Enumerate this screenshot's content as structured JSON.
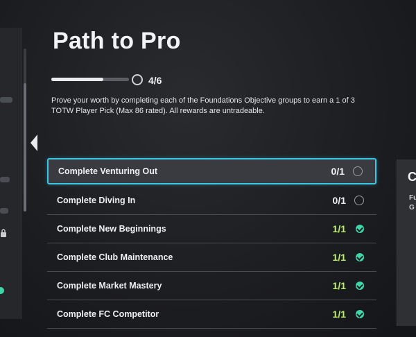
{
  "header": {
    "title": "Path to Pro",
    "progress_text": "4/6",
    "progress_fraction": 0.6667,
    "description": "Prove your worth by completing each of the Foundations Objective groups to earn a 1 of 3 TOTW Player Pick (Max 86 rated). All rewards are untradeable."
  },
  "objectives": [
    {
      "label": "Complete Venturing Out",
      "count": "0/1",
      "status": "empty-circle-icon"
    },
    {
      "label": "Complete Diving In",
      "count": "0/1",
      "status": "empty-circle-icon"
    },
    {
      "label": "Complete New Beginnings",
      "count": "1/1",
      "status": "check-icon"
    },
    {
      "label": "Complete Club Maintenance",
      "count": "1/1",
      "status": "check-icon"
    },
    {
      "label": "Complete Market Mastery",
      "count": "1/1",
      "status": "check-icon"
    },
    {
      "label": "Complete FC Competitor",
      "count": "1/1",
      "status": "check-icon"
    }
  ],
  "right_panel": {
    "initial": "C",
    "line1": "Fu",
    "line2": "G"
  },
  "colors": {
    "accent": "#39c7e6",
    "complete": "#3ed7a6",
    "count_done": "#bff06a"
  }
}
